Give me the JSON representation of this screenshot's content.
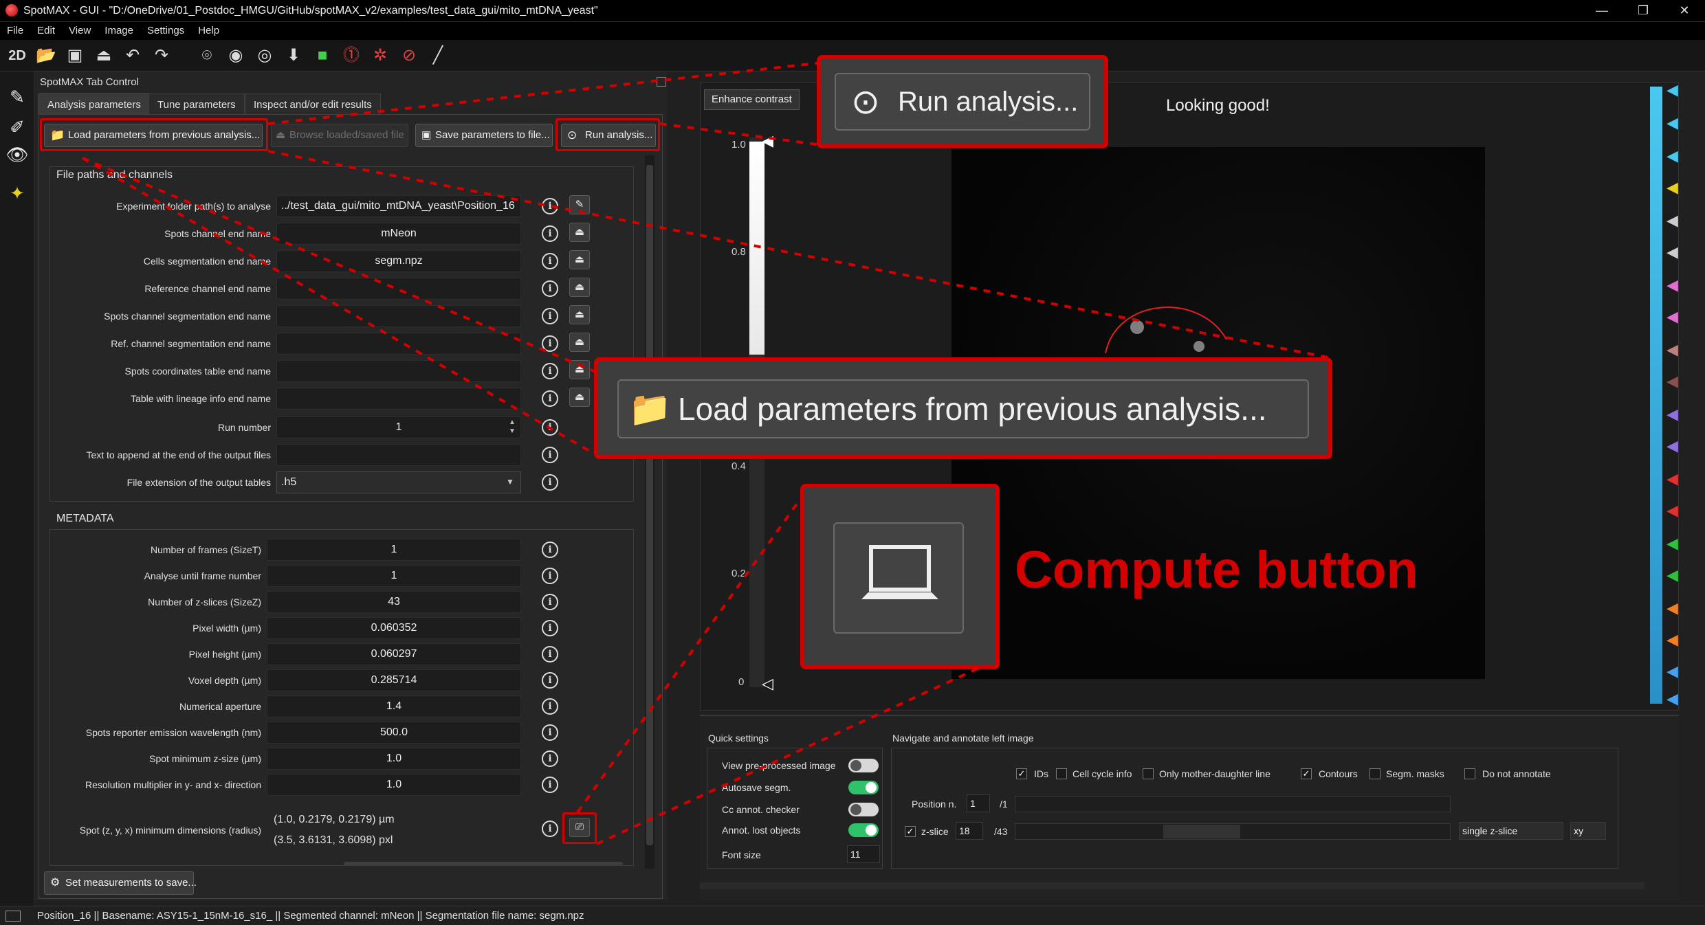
{
  "window": {
    "title": "SpotMAX - GUI - \"D:/OneDrive/01_Postdoc_HMGU/GitHub/spotMAX_v2/examples/test_data_gui/mito_mtDNA_yeast\"",
    "minimize": "—",
    "maximize": "❐",
    "close": "✕"
  },
  "menu": [
    "File",
    "Edit",
    "View",
    "Image",
    "Settings",
    "Help"
  ],
  "toolbar": {
    "mode_2d": "2D"
  },
  "panel": {
    "title": "SpotMAX Tab Control",
    "tabs": [
      "Analysis parameters",
      "Tune parameters",
      "Inspect and/or edit results"
    ],
    "buttons": {
      "load": "Load parameters from previous analysis...",
      "browse": "Browse loaded/saved file",
      "save": "Save parameters to file...",
      "run": "Run analysis..."
    }
  },
  "file_paths": {
    "title": "File paths and channels",
    "rows": [
      {
        "label": "Experiment folder path(s) to analyse",
        "value": "../test_data_gui/mito_mtDNA_yeast\\Position_16"
      },
      {
        "label": "Spots channel end name",
        "value": "mNeon"
      },
      {
        "label": "Cells segmentation end name",
        "value": "segm.npz"
      },
      {
        "label": "Reference channel end name",
        "value": ""
      },
      {
        "label": "Spots channel segmentation end name",
        "value": ""
      },
      {
        "label": "Ref. channel segmentation end name",
        "value": ""
      },
      {
        "label": "Spots coordinates table end name",
        "value": ""
      },
      {
        "label": "Table with lineage info end name",
        "value": ""
      },
      {
        "label": "Run number",
        "value": "1"
      },
      {
        "label": "Text to append at the end of the output files",
        "value": ""
      },
      {
        "label": "File extension of the output tables",
        "value": ".h5"
      }
    ]
  },
  "metadata": {
    "title": "METADATA",
    "rows": [
      {
        "label": "Number of frames (SizeT)",
        "value": "1"
      },
      {
        "label": "Analyse until frame number",
        "value": "1"
      },
      {
        "label": "Number of z-slices (SizeZ)",
        "value": "43"
      },
      {
        "label": "Pixel width (µm)",
        "value": "0.060352"
      },
      {
        "label": "Pixel height (µm)",
        "value": "0.060297"
      },
      {
        "label": "Voxel depth (µm)",
        "value": "0.285714"
      },
      {
        "label": "Numerical aperture",
        "value": "1.4"
      },
      {
        "label": "Spots reporter emission wavelength (nm)",
        "value": "500.0"
      },
      {
        "label": "Spot minimum z-size (µm)",
        "value": "1.0"
      },
      {
        "label": "Resolution multiplier in y- and x- direction",
        "value": "1.0"
      }
    ],
    "spot_dims_label": "Spot (z, y, x) minimum dimensions (radius)",
    "spot_dims_um": "(1.0, 0.2179, 0.2179) µm",
    "spot_dims_pxl": "(3.5, 3.6131, 3.6098) pxl"
  },
  "set_measurements": "Set measurements to save...",
  "image_view": {
    "enhance_contrast": "Enhance contrast",
    "status_msg": "Looking good!",
    "ticks": [
      "1.0",
      "0.8",
      "0.4",
      "0.2",
      "0"
    ]
  },
  "quick_settings": {
    "title": "Quick settings",
    "items": [
      {
        "label": "View pre-processed image",
        "on": false
      },
      {
        "label": "Autosave segm.",
        "on": true
      },
      {
        "label": "Cc annot. checker",
        "on": false
      },
      {
        "label": "Annot. lost objects",
        "on": true
      }
    ],
    "font_size_label": "Font size",
    "font_size": "11"
  },
  "navigate": {
    "title": "Navigate and annotate left image",
    "checkboxes": [
      {
        "label": "IDs",
        "checked": true
      },
      {
        "label": "Cell cycle info",
        "checked": false
      },
      {
        "label": "Only mother-daughter line",
        "checked": false
      },
      {
        "label": "Contours",
        "checked": true
      },
      {
        "label": "Segm. masks",
        "checked": false
      },
      {
        "label": "Do not annotate",
        "checked": false
      }
    ],
    "position_label": "Position n.",
    "position_value": "1",
    "position_total": "/1",
    "zslice_label": "z-slice",
    "zslice_value": "18",
    "zslice_total": "/43",
    "projection": "single z-slice",
    "plane": "xy"
  },
  "statusbar": "Position_16 || Basename: ASY15-1_15nM-16_s16_ || Segmented channel: mNeon || Segmentation file name: segm.npz",
  "callouts": {
    "run": "Run analysis...",
    "load": "Load parameters from previous analysis...",
    "compute": "Compute button"
  },
  "colors": {
    "highlight": "#d40000",
    "toggle_on": "#2fc26a"
  }
}
